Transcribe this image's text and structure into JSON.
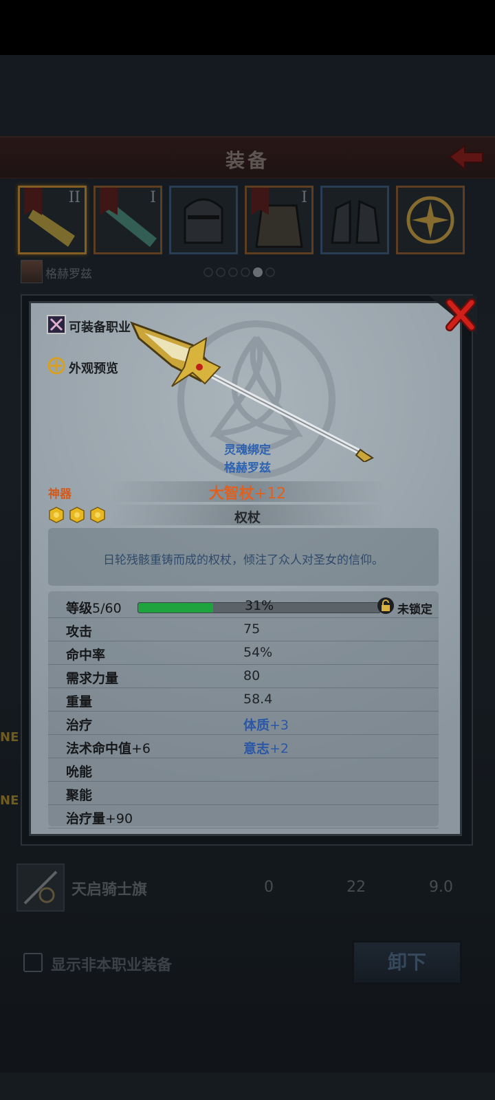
{
  "header": {
    "title": "装备"
  },
  "slots": [
    {
      "tier": "II",
      "flag": true,
      "style": "sel"
    },
    {
      "tier": "I",
      "flag": true,
      "style": "orange"
    },
    {
      "tier": "",
      "flag": false,
      "style": "blue"
    },
    {
      "tier": "I",
      "flag": true,
      "style": "orange"
    },
    {
      "tier": "",
      "flag": false,
      "style": "blue"
    },
    {
      "tier": "",
      "flag": false,
      "style": "orange"
    }
  ],
  "character": {
    "name": "格赫罗兹"
  },
  "page_dots": {
    "count": 6,
    "active": 5
  },
  "list": {
    "new_badges": [
      "NE",
      "NE"
    ],
    "row": {
      "name": "天启骑士旗",
      "values": [
        "0",
        "22",
        "9.0"
      ]
    }
  },
  "filter": {
    "label": "显示非本职业装备",
    "checked": false
  },
  "unequip_button": {
    "label": "卸下"
  },
  "modal": {
    "buttons": {
      "classes": "可装备职业",
      "preview": "外观预览"
    },
    "soulbound": "灵魂绑定",
    "owner": "格赫罗兹",
    "rarity": "神器",
    "item_name": "大智杖",
    "item_level": "+12",
    "stars": 3,
    "item_type": "权杖",
    "description": "日轮残骸重铸而成的权杖，倾注了众人对圣女的信仰。",
    "level": {
      "label": "等级",
      "value": "5/60",
      "progress": 0.31,
      "percent_text": "31%",
      "lock_label": "未锁定"
    },
    "stats": [
      {
        "name": "攻击",
        "name_suffix": "",
        "value": "75",
        "value_suffix": "",
        "blue": false
      },
      {
        "name": "命中率",
        "name_suffix": "",
        "value": "54%",
        "value_suffix": "",
        "blue": false
      },
      {
        "name": "需求力量",
        "name_suffix": "",
        "value": "80",
        "value_suffix": "",
        "blue": false
      },
      {
        "name": "重量",
        "name_suffix": "",
        "value": "58.4",
        "value_suffix": "",
        "blue": false
      },
      {
        "name": "治疗",
        "name_suffix": "",
        "value": "体质",
        "value_suffix": "+3",
        "blue": true
      },
      {
        "name": "法术命中值",
        "name_suffix": "+6",
        "value": "意志",
        "value_suffix": "+2",
        "blue": true
      },
      {
        "name": "吮能",
        "name_suffix": "",
        "value": "",
        "value_suffix": "",
        "blue": false
      },
      {
        "name": "聚能",
        "name_suffix": "",
        "value": "",
        "value_suffix": "",
        "blue": false
      },
      {
        "name": "治疗量",
        "name_suffix": "+90",
        "value": "",
        "value_suffix": "",
        "blue": false
      }
    ]
  },
  "colors": {
    "rarity": "#e0601e",
    "bound": "#2f63b0",
    "progress": "#1fa33e",
    "header": "#3a1e1c"
  }
}
